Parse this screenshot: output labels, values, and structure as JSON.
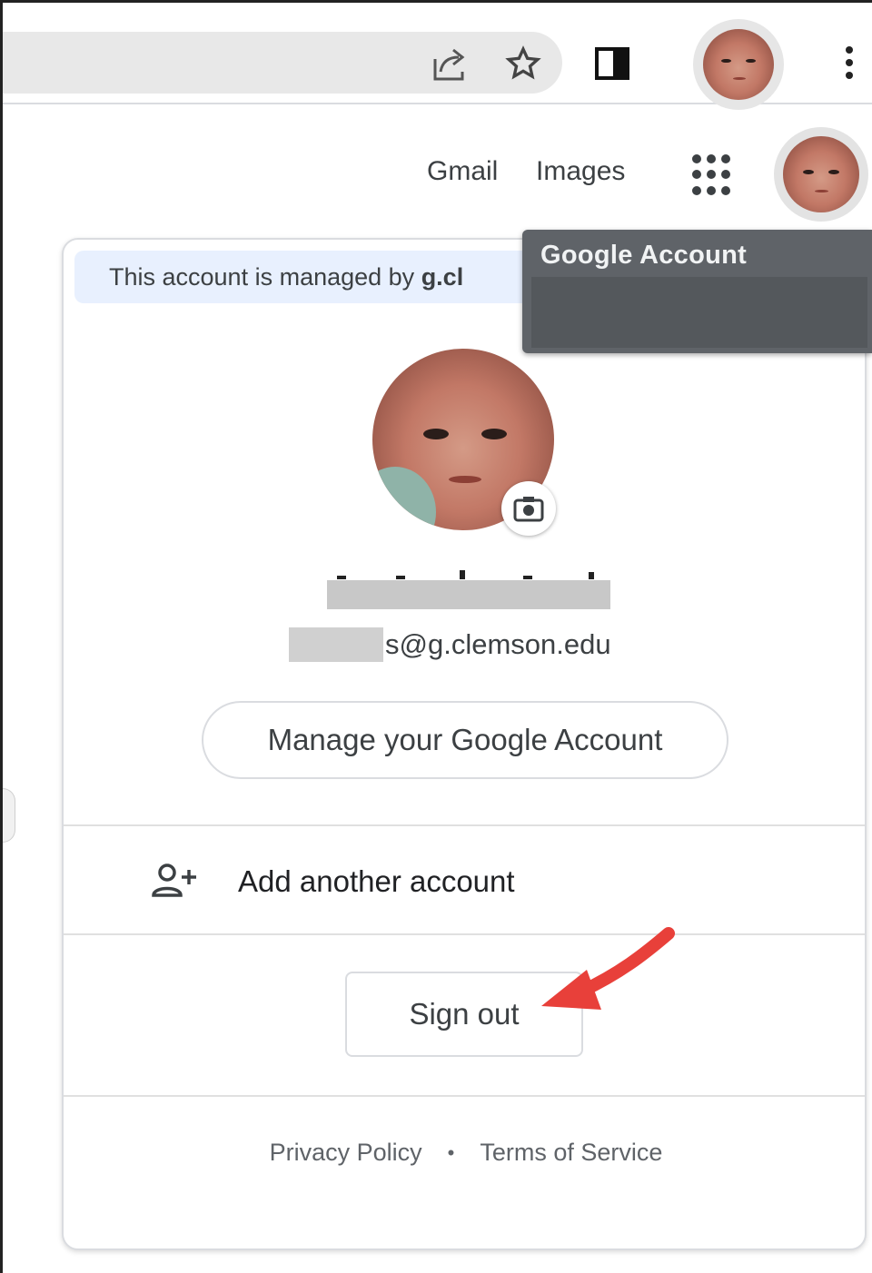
{
  "browser": {
    "share_icon": "share-icon",
    "bookmark_icon": "star-icon",
    "side_panel_icon": "side-panel-icon",
    "profile_icon": "profile-avatar",
    "menu_icon": "kebab-menu-icon"
  },
  "header": {
    "gmail": "Gmail",
    "images": "Images",
    "apps_icon": "google-apps-icon"
  },
  "tooltip": {
    "title": "Google Account"
  },
  "card": {
    "managed_prefix": "This account is managed by ",
    "managed_domain": "g.cl",
    "email_visible_suffix": "s@g.clemson.edu",
    "manage_button": "Manage your Google Account",
    "add_account": "Add another account",
    "sign_out": "Sign out",
    "privacy": "Privacy Policy",
    "dot": "•",
    "terms": "Terms of Service"
  },
  "colors": {
    "banner_bg": "#e8f0fe",
    "tooltip_bg": "#5f6368",
    "arrow": "#e8403a"
  }
}
